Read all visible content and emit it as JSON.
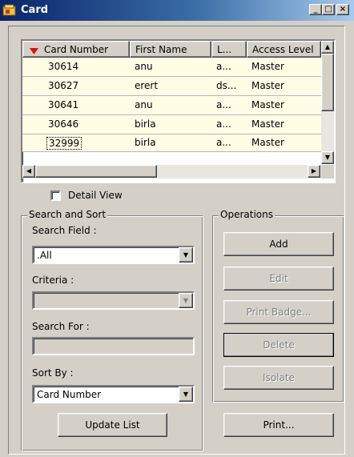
{
  "window": {
    "title": "Card",
    "minimize": "_",
    "maximize": "□",
    "close": "×"
  },
  "grid": {
    "columns": [
      "Card Number",
      "First Name",
      "L...",
      "Access Level"
    ],
    "rows": [
      [
        "30614",
        "anu",
        "a...",
        "Master"
      ],
      [
        "30627",
        "erert",
        "ds...",
        "Master"
      ],
      [
        "30641",
        "anu",
        "a...",
        "Master"
      ],
      [
        "30646",
        "birla",
        "a...",
        "Master"
      ],
      [
        "32999",
        "birla",
        "a...",
        "Master"
      ]
    ],
    "sort_indicator_color": "#e01010"
  },
  "detail_view": {
    "label": "Detail View",
    "checked": false
  },
  "search_sort": {
    "group_label": "Search and Sort",
    "search_field_label": "Search Field :",
    "search_field_value": ".All",
    "criteria_label": "Criteria :",
    "criteria_value": "",
    "search_for_label": "Search For :",
    "search_for_value": "",
    "sort_by_label": "Sort By :",
    "sort_by_value": "Card Number",
    "update_button": "Update List"
  },
  "operations": {
    "group_label": "Operations",
    "add": "Add",
    "edit": "Edit",
    "print_badge": "Print Badge...",
    "delete": "Delete",
    "isolate": "Isolate",
    "print": "Print..."
  }
}
